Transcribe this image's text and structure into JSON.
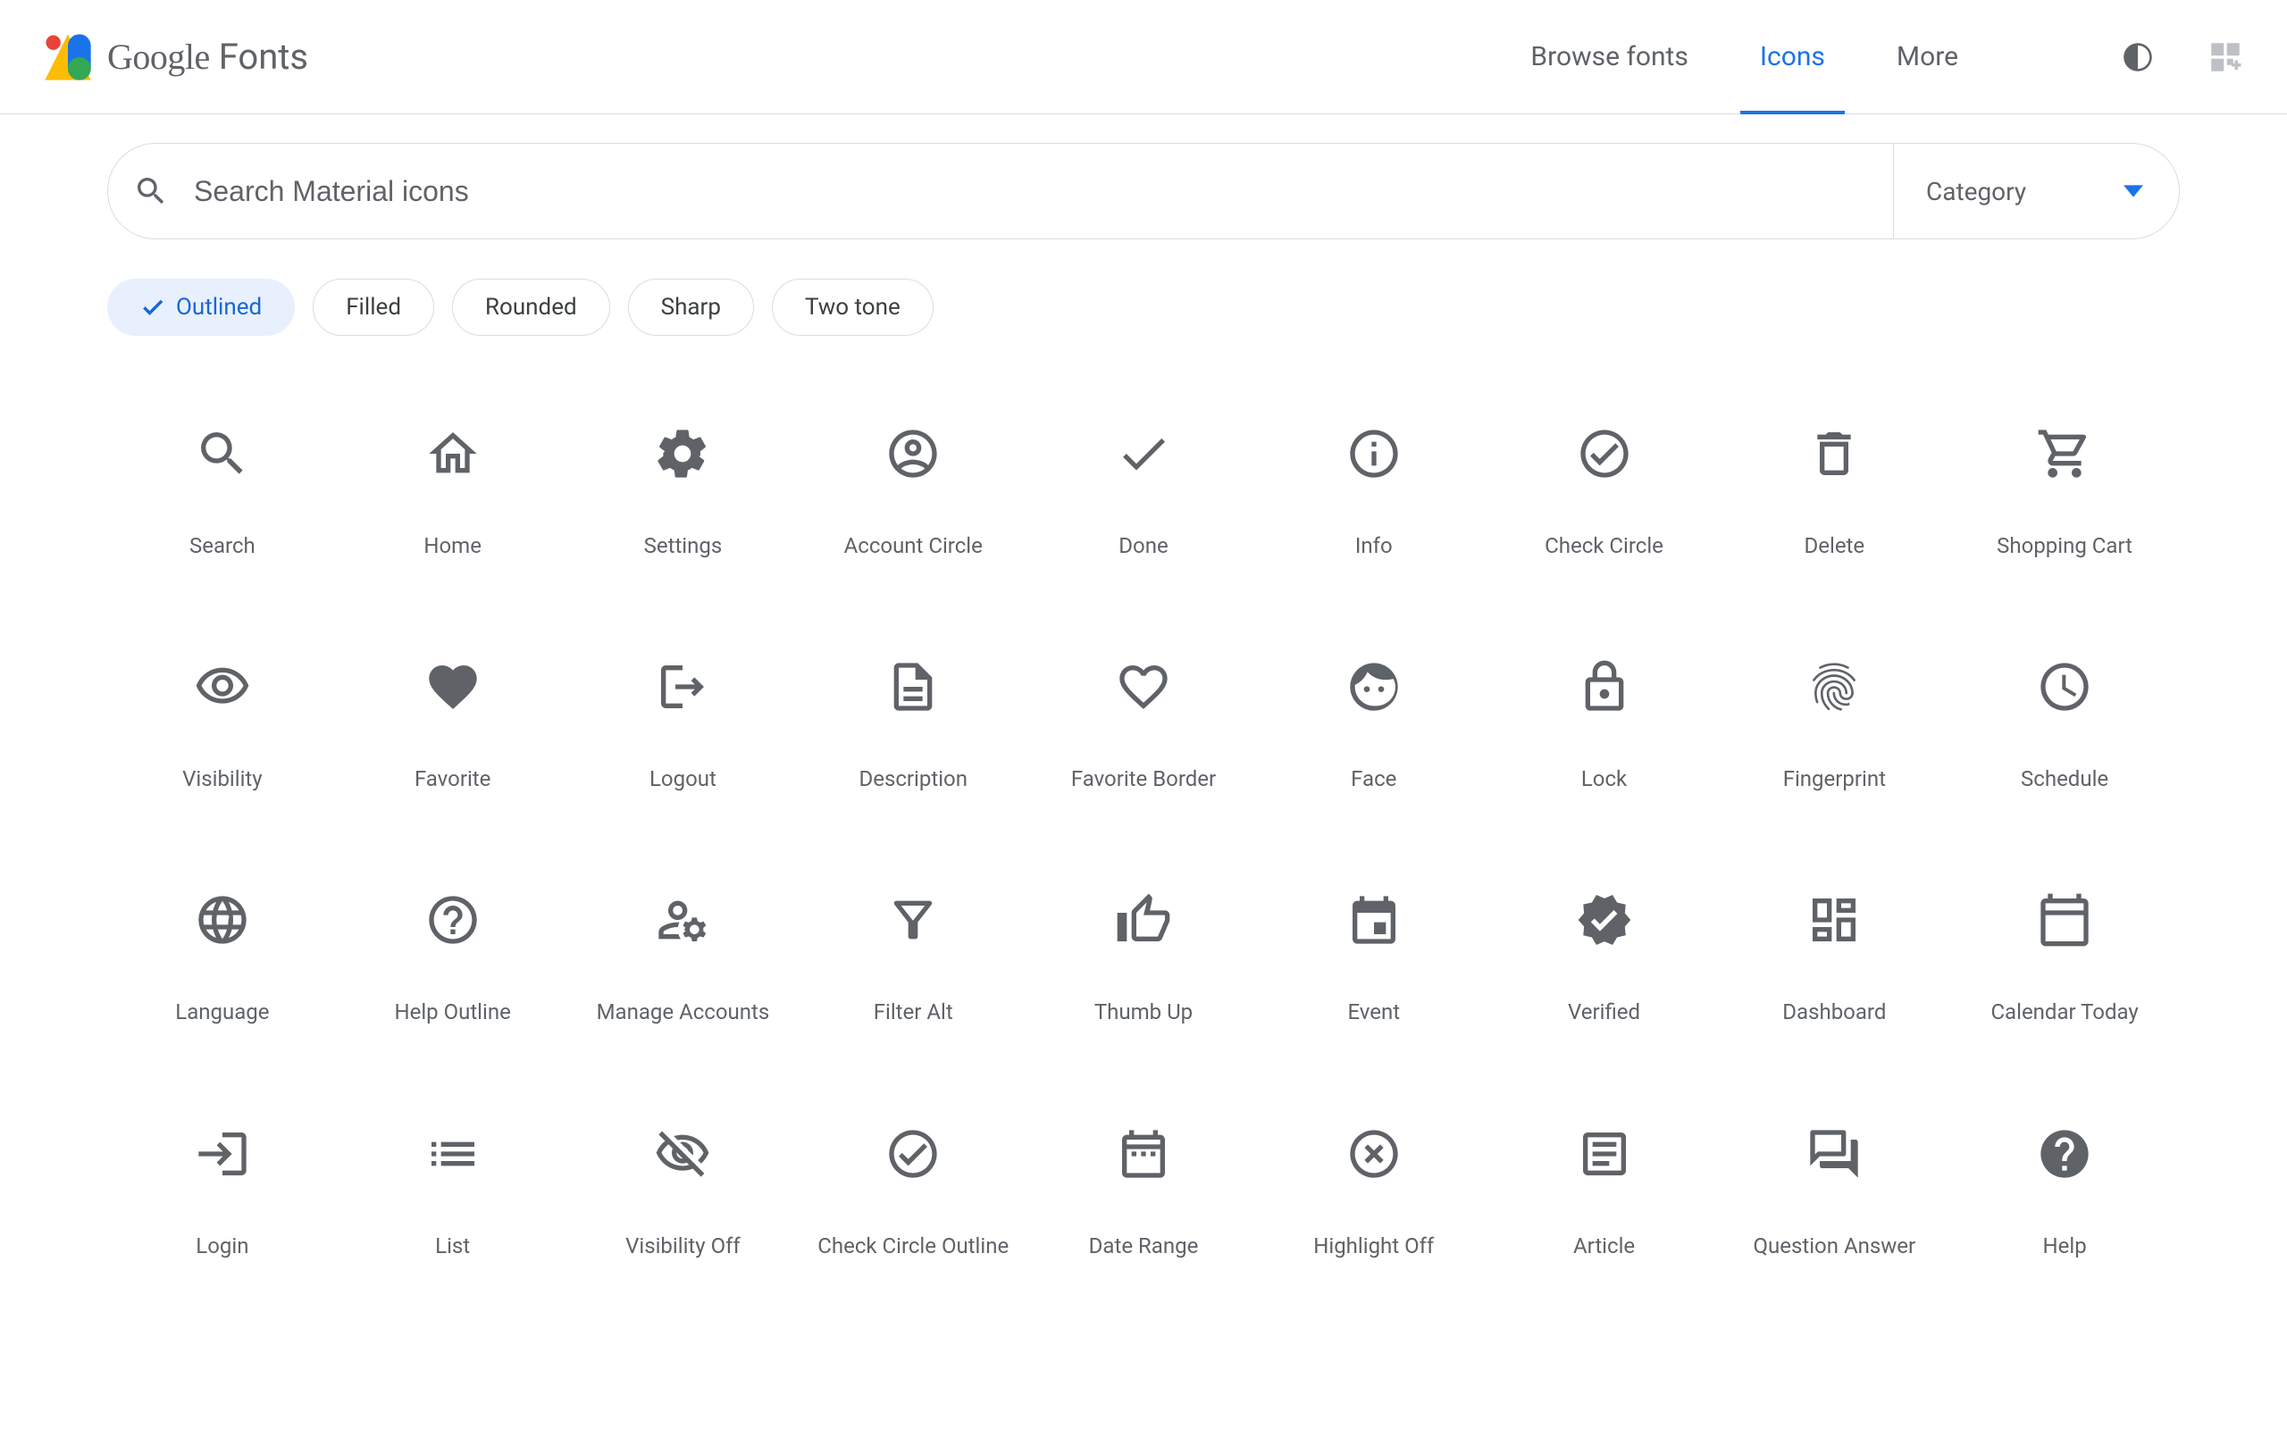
{
  "header": {
    "logo_text_bold": "Google",
    "logo_text_light": "Fonts",
    "nav": [
      {
        "label": "Browse fonts"
      },
      {
        "label": "Icons"
      },
      {
        "label": "More"
      }
    ]
  },
  "search": {
    "placeholder": "Search Material icons",
    "category_label": "Category"
  },
  "chips": [
    {
      "label": "Outlined",
      "active": true
    },
    {
      "label": "Filled"
    },
    {
      "label": "Rounded"
    },
    {
      "label": "Sharp"
    },
    {
      "label": "Two tone"
    }
  ],
  "icons": [
    {
      "name": "search",
      "label": "Search"
    },
    {
      "name": "home",
      "label": "Home"
    },
    {
      "name": "settings",
      "label": "Settings"
    },
    {
      "name": "account_circle",
      "label": "Account Circle"
    },
    {
      "name": "done",
      "label": "Done"
    },
    {
      "name": "info",
      "label": "Info"
    },
    {
      "name": "check_circle",
      "label": "Check Circle"
    },
    {
      "name": "delete",
      "label": "Delete"
    },
    {
      "name": "shopping_cart",
      "label": "Shopping Cart"
    },
    {
      "name": "visibility",
      "label": "Visibility"
    },
    {
      "name": "favorite",
      "label": "Favorite"
    },
    {
      "name": "logout",
      "label": "Logout"
    },
    {
      "name": "description",
      "label": "Description"
    },
    {
      "name": "favorite_border",
      "label": "Favorite Border"
    },
    {
      "name": "face",
      "label": "Face"
    },
    {
      "name": "lock",
      "label": "Lock"
    },
    {
      "name": "fingerprint",
      "label": "Fingerprint"
    },
    {
      "name": "schedule",
      "label": "Schedule"
    },
    {
      "name": "language",
      "label": "Language"
    },
    {
      "name": "help_outline",
      "label": "Help Outline"
    },
    {
      "name": "manage_accounts",
      "label": "Manage Accounts"
    },
    {
      "name": "filter_alt",
      "label": "Filter Alt"
    },
    {
      "name": "thumb_up",
      "label": "Thumb Up"
    },
    {
      "name": "event",
      "label": "Event"
    },
    {
      "name": "verified",
      "label": "Verified"
    },
    {
      "name": "dashboard",
      "label": "Dashboard"
    },
    {
      "name": "calendar_today",
      "label": "Calendar Today"
    },
    {
      "name": "login",
      "label": "Login"
    },
    {
      "name": "list",
      "label": "List"
    },
    {
      "name": "visibility_off",
      "label": "Visibility Off"
    },
    {
      "name": "check_circle_outline",
      "label": "Check Circle Outline"
    },
    {
      "name": "date_range",
      "label": "Date Range"
    },
    {
      "name": "highlight_off",
      "label": "Highlight Off"
    },
    {
      "name": "article",
      "label": "Article"
    },
    {
      "name": "question_answer",
      "label": "Question Answer"
    },
    {
      "name": "help",
      "label": "Help"
    }
  ]
}
